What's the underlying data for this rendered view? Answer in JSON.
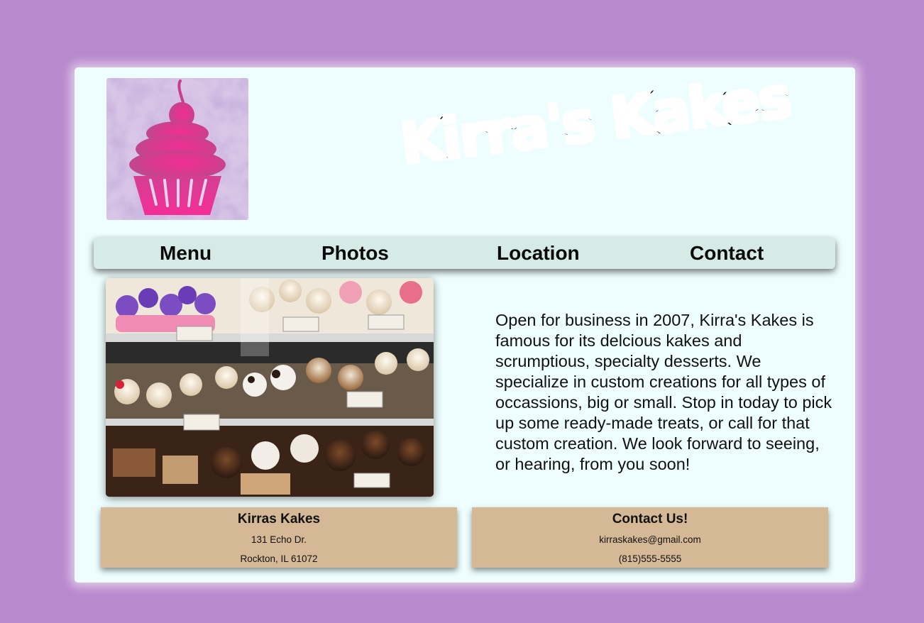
{
  "header": {
    "brand_name": "Kirra's Kakes"
  },
  "nav": {
    "items": [
      {
        "label": "Menu"
      },
      {
        "label": "Photos"
      },
      {
        "label": "Location"
      },
      {
        "label": "Contact"
      }
    ]
  },
  "main": {
    "about_text": "Open for business in 2007, Kirra's Kakes is famous for its delcious kakes and scrumptious, specialty desserts. We specialize in custom creations for all types of occassions, big or small. Stop in today to pick up some ready-made treats, or call for that custom creation. We look forward to seeing, or hearing, from you soon!"
  },
  "footer": {
    "address_box": {
      "title": "Kirras Kakes",
      "street": "131 Echo Dr.",
      "city": "Rockton, IL 61072"
    },
    "contact_box": {
      "title": "Contact Us!",
      "email": "kirraskakes@gmail.com",
      "phone": "(815)555-5555"
    }
  },
  "colors": {
    "page_background": "#b889cd",
    "card_background": "#eefefe",
    "nav_background": "#d6ebe6",
    "footer_box_background": "#d5b996",
    "logo_pink": "#e8318e"
  },
  "icons": {
    "logo": "cupcake-logo-icon"
  }
}
